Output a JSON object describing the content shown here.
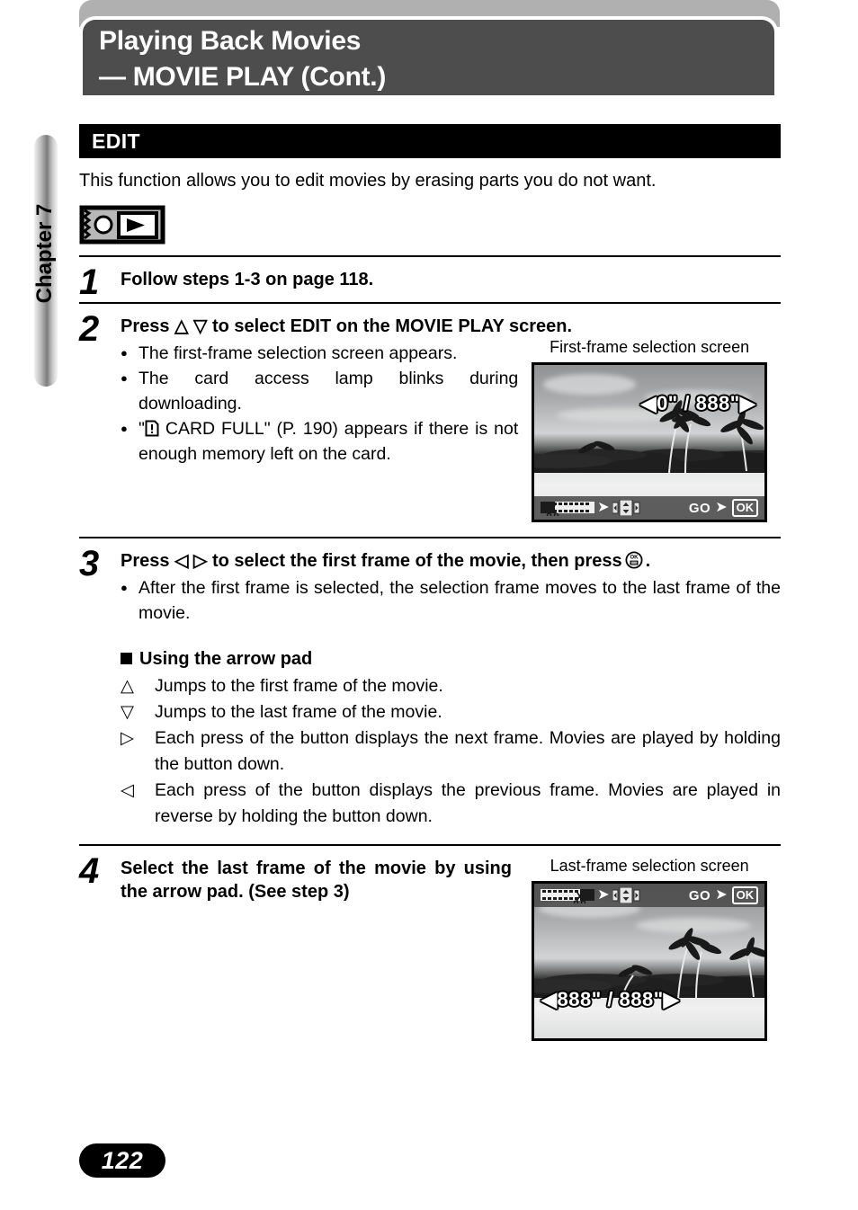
{
  "header": {
    "title_line1": "Playing Back Movies",
    "title_line2": "— MOVIE PLAY (Cont.)"
  },
  "chapter_tab": {
    "label": "Chapter 7"
  },
  "section": {
    "band_label": "EDIT",
    "intro": "This function allows you to edit movies by erasing parts you do not want.",
    "mode_icon": "playback-mode-dial-icon"
  },
  "steps": [
    {
      "number": "1",
      "heading": "Follow steps 1-3 on page 118.",
      "bullets": []
    },
    {
      "number": "2",
      "heading_before": "Press",
      "heading_keys": "△ ▽",
      "heading_after": "to select EDIT on the MOVIE PLAY screen.",
      "bullets": [
        "The first-frame selection screen appears.",
        "The card access lamp blinks during downloading.",
        "\"[!]  CARD FULL\" (P. 190) appears if there is not enough memory left on the card."
      ],
      "bullet3_prefix": "\"",
      "bullet3_icon": "card-full-warning-icon",
      "bullet3_text": "CARD FULL\" (P. 190) appears if there is not enough memory left on the card."
    },
    {
      "number": "3",
      "heading_before": "Press",
      "heading_keys": "◁ ▷",
      "heading_after": "to select the first frame of the movie, then press",
      "heading_end": ".",
      "bullets": [
        "After the first frame is selected, the selection frame moves to the last frame of the movie."
      ]
    },
    {
      "number": "4",
      "heading": "Select the last frame of the movie by using the arrow pad. (See step 3)",
      "bullets": []
    }
  ],
  "arrow_pad": {
    "title": "Using the arrow pad",
    "items": [
      {
        "key": "△",
        "sep": ":",
        "desc": "Jumps to the first frame of the movie."
      },
      {
        "key": "▽",
        "sep": ":",
        "desc": "Jumps to the last frame of the movie."
      },
      {
        "key": "▷",
        "sep": ":",
        "desc": "Each press of the button displays the next frame. Movies are played by holding the button down."
      },
      {
        "key": "◁",
        "sep": ":",
        "desc": "Each press of the button displays the previous frame. Movies are played in reverse by holding the button down."
      }
    ]
  },
  "screens": {
    "first_frame": {
      "caption": "First-frame selection screen",
      "timecode": "◀0\" / 888\"▶",
      "timecode_position": "top-right",
      "bar_position": "bottom",
      "bar_left_icons": [
        "filmstrip-scissors-icon",
        "right-arrow-icon",
        "arrow-pad-icon"
      ],
      "go_label": "GO",
      "ok_label": "OK"
    },
    "last_frame": {
      "caption": "Last-frame selection screen",
      "timecode": "◀888\" / 888\"▶",
      "timecode_position": "bottom-left",
      "bar_position": "top",
      "bar_left_icons": [
        "filmstrip-scissors-icon",
        "right-arrow-icon",
        "arrow-pad-icon"
      ],
      "go_label": "GO",
      "ok_label": "OK"
    }
  },
  "page_number": "122",
  "colors": {
    "header_bg": "#4d4d4d",
    "header_shadow": "#b0b0b0",
    "band_bg": "#000000",
    "text": "#000000",
    "lcd_bar": "#4a4a4a"
  }
}
